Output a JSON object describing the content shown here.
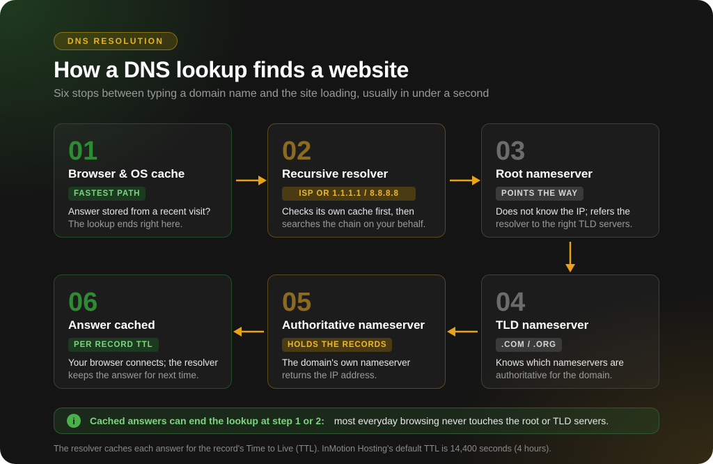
{
  "header": {
    "eyebrow": "DNS RESOLUTION",
    "title": "How a DNS lookup finds a website",
    "subtitle": "Six stops between typing a domain name and the site loading, usually in under a second"
  },
  "steps": [
    {
      "num": "01",
      "title": "Browser & OS cache",
      "badge": "FASTEST PATH",
      "line1": "Answer stored from a recent visit?",
      "line2": "The lookup ends right here."
    },
    {
      "num": "02",
      "title": "Recursive resolver",
      "badge": "ISP OR 1.1.1.1 / 8.8.8.8",
      "line1": "Checks its own cache first, then",
      "line2": "searches the chain on your behalf."
    },
    {
      "num": "03",
      "title": "Root nameserver",
      "badge": "POINTS THE WAY",
      "line1": "Does not know the IP; refers the",
      "line2": "resolver to the right TLD servers."
    },
    {
      "num": "04",
      "title": "TLD nameserver",
      "badge": ".COM / .ORG",
      "line1": "Knows which nameservers are",
      "line2": "authoritative for the domain."
    },
    {
      "num": "05",
      "title": "Authoritative nameserver",
      "badge": "HOLDS THE RECORDS",
      "line1": "The domain's own nameserver",
      "line2": "returns the IP address."
    },
    {
      "num": "06",
      "title": "Answer cached",
      "badge": "PER RECORD TTL",
      "line1": "Your browser connects; the resolver",
      "line2": "keeps the answer for next time."
    }
  ],
  "note": {
    "icon": "info-icon",
    "icon_glyph": "i",
    "strong": "Cached answers can end the lookup at step 1 or 2:",
    "rest": "most everyday browsing never touches the root or TLD servers."
  },
  "footnote": "The resolver caches each answer for the record's Time to Live (TTL). InMotion Hosting's default TTL is 14,400 seconds (4 hours).",
  "colors": {
    "green": "#2f8b33",
    "amber": "#e8a317",
    "gray": "#6c6c6c",
    "background": "#141414"
  }
}
